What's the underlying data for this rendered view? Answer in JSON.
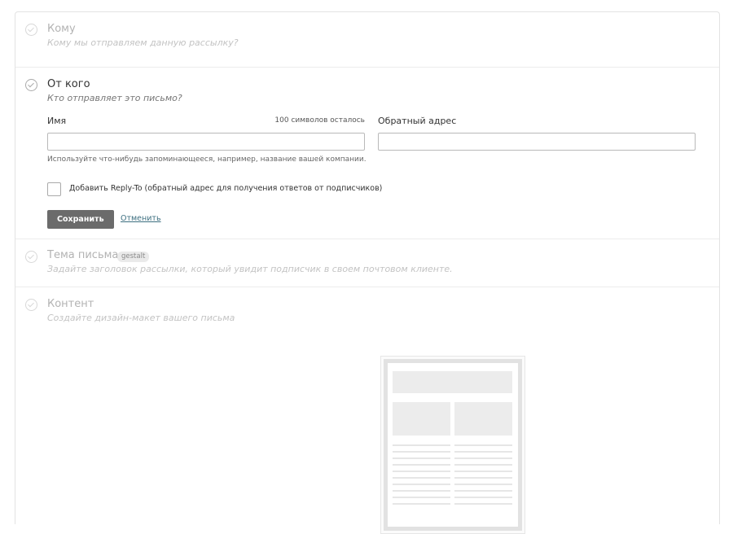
{
  "sections": {
    "to": {
      "title": "Кому",
      "subtitle": "Кому мы отправляем данную рассылку?"
    },
    "from": {
      "title": "От кого",
      "subtitle": "Кто отправляет это письмо?",
      "name_label": "Имя",
      "name_counter": "100 символов осталось",
      "name_value": "",
      "reply_label": "Обратный адрес",
      "reply_value": "",
      "hint": "Используйте что-нибудь запоминающееся, например, название вашей компании.",
      "reply_to_checkbox_label": "Добавить Reply-To (обратный адрес для получения ответов от подписчиков)",
      "reply_to_checked": false,
      "save_label": "Сохранить",
      "cancel_label": "Отменить"
    },
    "subject": {
      "title": "Тема письма",
      "tag": "gestalt",
      "subtitle": "Задайте заголовок рассылки, который увидит подписчик в своем почтовом клиенте."
    },
    "content": {
      "title": "Контент",
      "subtitle": "Создайте дизайн-макет вашего письма"
    }
  },
  "colors": {
    "accent_link": "#3d6f80",
    "save_button_bg": "#6b6b6b",
    "muted_text": "#b3b3b3"
  },
  "icons": {
    "step_check": "check-circle-icon",
    "template_preview": "email-template-icon"
  }
}
